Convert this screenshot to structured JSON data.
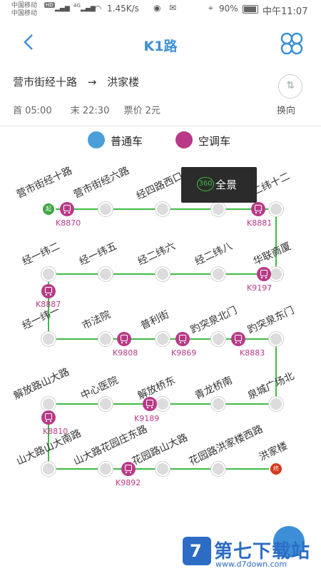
{
  "status_bar": {
    "carrier1": "中国移动",
    "hd": "HD",
    "carrier2": "中国移动",
    "net": "4G",
    "speed": "1.45K/s",
    "battery": "90%",
    "time": "中午11:07"
  },
  "header": {
    "title": "K1路",
    "back_icon": "back-arrow-icon",
    "menu_icon": "grid-menu-icon"
  },
  "route": {
    "from": "营市街经十路",
    "arrow": "→",
    "to": "洪家楼",
    "first": "首 05:00",
    "last": "末 22:30",
    "fare": "票价 2元",
    "swap_label": "换向"
  },
  "legend": {
    "normal": "普通车",
    "ac": "空调车",
    "normal_color": "#4a9fd8",
    "ac_color": "#b83a87"
  },
  "panorama": {
    "badge": "360",
    "label": "全景"
  },
  "line_color": "#3fbb45",
  "stops": {
    "s1": "营市街经十路",
    "s2": "营市街经六路",
    "s3": "经四路西口",
    "s4": "经二纬十二",
    "start_mark": "起",
    "end_mark": "终",
    "s5": "经一纬二",
    "s6": "经一纬五",
    "s7": "经二纬六",
    "s8": "经二纬八",
    "s9": "华联商厦",
    "s10": "经一纬一",
    "s11": "市法院",
    "s12": "普利街",
    "s13": "趵突泉北门",
    "s14": "趵突泉东门",
    "s15": "解放路山大路",
    "s16": "中心医院",
    "s17": "解放桥东",
    "s18": "青龙桥南",
    "s19": "泉城广场北",
    "s20": "山大路山大南路",
    "s21": "山大路花园庄东路",
    "s22": "花园路山大路",
    "s23": "花园路洪家楼西路",
    "s24": "洪家楼"
  },
  "buses": {
    "b1": "K8870",
    "b2": "K8881",
    "b3": "K9197",
    "b4": "K8887",
    "b5": "K9808",
    "b6": "K9869",
    "b7": "K8883",
    "b8": "K9189",
    "b9": "K8810",
    "b10": "K9892"
  },
  "watermark": {
    "title": "第七下载站",
    "url": "www.d7down.com"
  }
}
